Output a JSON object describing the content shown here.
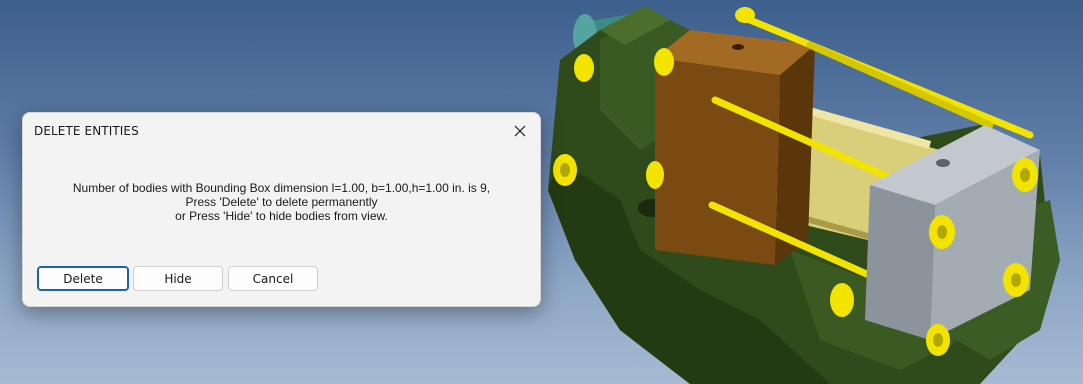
{
  "dialog": {
    "title": "DELETE ENTITIES",
    "close_icon": "close-icon",
    "message_line1": "Number of bodies with Bounding Box dimension l=1.00, b=1.00,h=1.00 in. is 9,",
    "message_line2": "Press 'Delete' to delete permanently",
    "message_line3": "or Press 'Hide' to hide bodies from view.",
    "buttons": {
      "delete": "Delete",
      "hide": "Hide",
      "cancel": "Cancel"
    }
  },
  "colors": {
    "viewport_top": "#3d5f8c",
    "viewport_bottom": "#a7bad3",
    "base_green": "#2f4a1b",
    "cylinder_yellow": "#d9cf7a",
    "flange_brown": "#7a4a12",
    "plate_gray": "#9aa2ab",
    "bolt_yellow": "#f2e400",
    "shaft_teal": "#3e8a86",
    "primary_button_border": "#1f5fb0"
  }
}
